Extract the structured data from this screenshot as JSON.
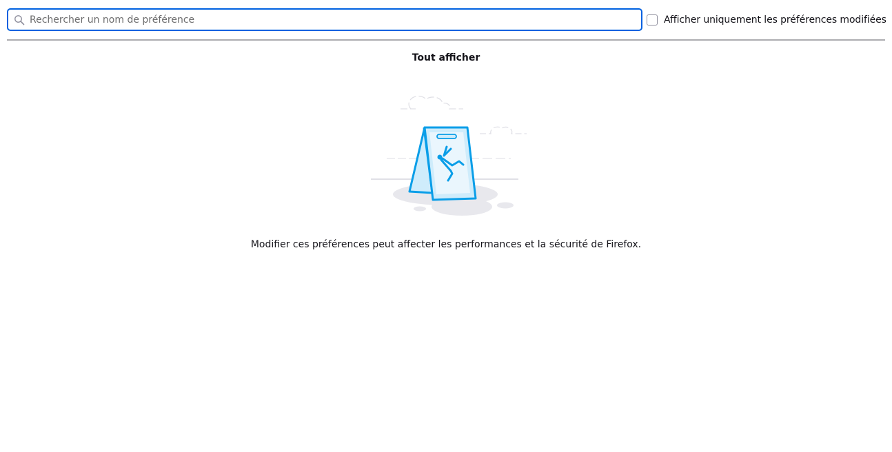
{
  "search": {
    "placeholder": "Rechercher un nom de préférence",
    "value": "",
    "icon": "search-icon"
  },
  "filter": {
    "checked": false,
    "label": "Afficher uniquement les préférences modifiées"
  },
  "show_all_label": "Tout afficher",
  "illustration": {
    "icon": "falling-person-warning-sign-icon"
  },
  "warning_text": "Modifier ces préférences peut affecter les performances et la sécurité de Firefox.",
  "colors": {
    "accent": "#0061e0",
    "illustration_blue": "#0a9ee8",
    "illustration_light": "#cfecfb",
    "shadow": "#e8e8ed"
  }
}
